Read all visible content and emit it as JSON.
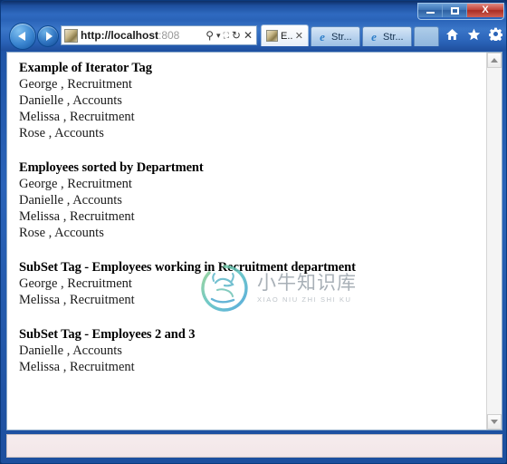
{
  "window": {
    "controls": {
      "minimize_label": "Minimize",
      "maximize_label": "Restore",
      "close_label": "X"
    }
  },
  "toolbar": {
    "back_label": "Back",
    "forward_label": "Forward",
    "address": {
      "favicon": "page-image-icon",
      "url_host": "http://localhost",
      "url_rest": ":808",
      "placeholder": "",
      "icons": [
        {
          "name": "search-icon",
          "glyph": "⌕"
        },
        {
          "name": "chevron-down-icon",
          "glyph": "▾"
        },
        {
          "name": "compatibility-view-icon",
          "glyph": "⛶"
        },
        {
          "name": "refresh-icon",
          "glyph": "↻"
        },
        {
          "name": "stop-icon",
          "glyph": "✕"
        }
      ]
    },
    "tabs": [
      {
        "label": "E...",
        "icon": "page-image-icon",
        "active": true,
        "close": "✕"
      },
      {
        "label": "Str...",
        "icon": "ie-logo-icon",
        "active": false
      },
      {
        "label": "Str...",
        "icon": "ie-logo-icon",
        "active": false
      }
    ],
    "new_tab_label": "",
    "right_icons": [
      {
        "name": "home-icon"
      },
      {
        "name": "favorites-star-icon"
      },
      {
        "name": "settings-gear-icon"
      }
    ]
  },
  "page": {
    "sections": [
      {
        "heading": "Example of Iterator Tag",
        "rows": [
          "George , Recruitment",
          "Danielle , Accounts",
          "Melissa , Recruitment",
          "Rose , Accounts"
        ]
      },
      {
        "heading": "Employees sorted by Department",
        "rows": [
          "George , Recruitment",
          "Danielle , Accounts",
          "Melissa , Recruitment",
          "Rose , Accounts"
        ]
      },
      {
        "heading": "SubSet Tag - Employees working in Recruitment department",
        "rows": [
          "George , Recruitment",
          "Melissa , Recruitment"
        ]
      },
      {
        "heading": "SubSet Tag - Employees 2 and 3",
        "rows": [
          "Danielle , Accounts",
          "Melissa , Recruitment"
        ]
      }
    ],
    "watermark": {
      "chinese": "小牛知识库",
      "pinyin": "XIAO NIU ZHI SHI KU"
    }
  },
  "scrollbar": {
    "up_label": "Scroll up",
    "down_label": "Scroll down"
  },
  "statusbar": {
    "text": ""
  },
  "colors": {
    "titlebar_blue": "#1d4f9e",
    "close_red": "#c2453a",
    "accent": "#2a63b8",
    "watermark_gray": "#9aa3ab"
  }
}
